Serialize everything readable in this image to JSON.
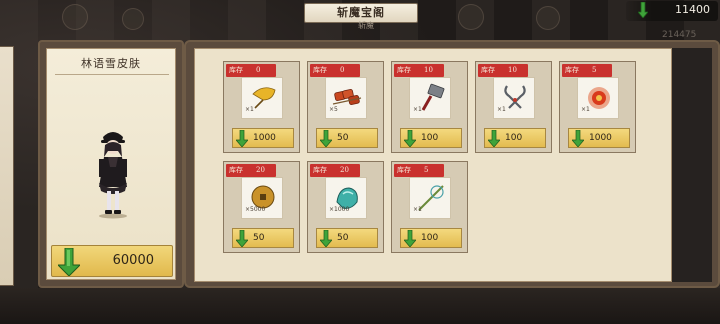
{
  "header": {
    "title": "斩魔宝阁",
    "subtitle": "斩魔"
  },
  "currency": {
    "icon": "green-arrow-gem-icon",
    "amount": "11400"
  },
  "background_number": "214475",
  "colors": {
    "gem_green": "#3fa33a",
    "stock_red": "#c9312e",
    "cost_gold": "#e6c15a",
    "panel_cream": "#ece2ca"
  },
  "featured": {
    "title": "林语雪皮肤",
    "price": "60000",
    "price_icon": "green-arrow-gem-icon"
  },
  "shop": {
    "stock_label": "库存",
    "items": [
      {
        "name": "ginkgo-leaf",
        "icon": "ginkgo-leaf-icon",
        "stock": "0",
        "qty": "×1",
        "price": "1000"
      },
      {
        "name": "meat-skewer",
        "icon": "meat-skewer-icon",
        "stock": "0",
        "qty": "×5",
        "price": "50"
      },
      {
        "name": "hammer",
        "icon": "hammer-icon",
        "stock": "10",
        "qty": "×1",
        "price": "100"
      },
      {
        "name": "pincers",
        "icon": "pincers-icon",
        "stock": "10",
        "qty": "×1",
        "price": "100"
      },
      {
        "name": "fire-orb",
        "icon": "fire-orb-icon",
        "stock": "5",
        "qty": "×1",
        "price": "1000"
      },
      {
        "name": "copper-coin",
        "icon": "copper-coin-icon",
        "stock": "20",
        "qty": "×5000",
        "price": "50"
      },
      {
        "name": "jade-crystal",
        "icon": "jade-crystal-icon",
        "stock": "20",
        "qty": "×1000",
        "price": "50"
      },
      {
        "name": "fishing-rod",
        "icon": "fishing-rod-icon",
        "stock": "5",
        "qty": "×1",
        "price": "100"
      }
    ]
  }
}
